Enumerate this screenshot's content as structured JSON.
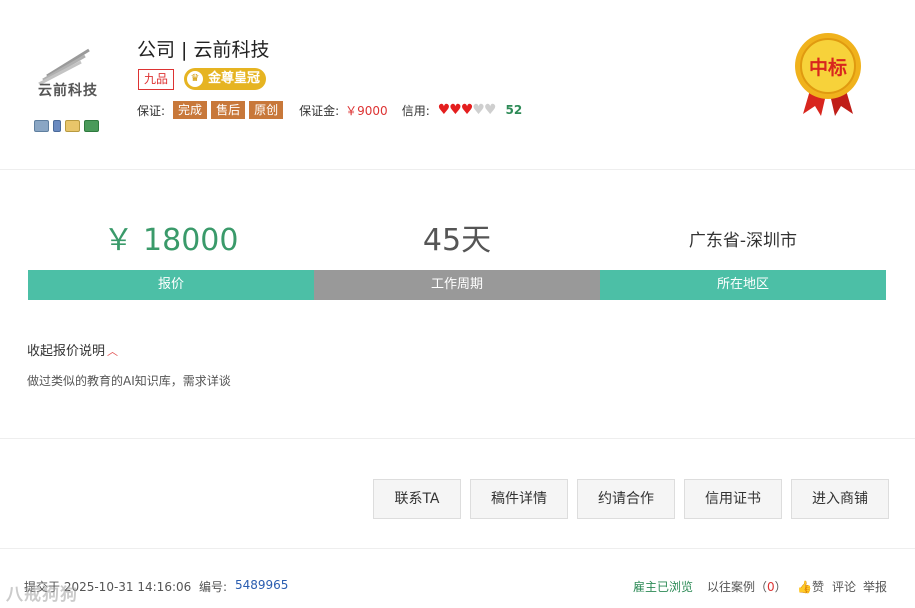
{
  "company": {
    "logo_text": "云前科技",
    "title": "公司 | 云前科技",
    "level_badge": "九品",
    "crown_badge": "金尊皇冠",
    "contact_icons": [
      "id-card-icon",
      "phone-icon",
      "mail-icon",
      "bank-card-icon"
    ]
  },
  "guarantee": {
    "label": "保证:",
    "tags": [
      "完成",
      "售后",
      "原创"
    ],
    "deposit_label": "保证金:",
    "deposit_value": "￥9000",
    "credit_label": "信用:",
    "hearts_filled": 3,
    "hearts_total": 5,
    "credit_score": "52"
  },
  "medal": {
    "text": "中标"
  },
  "stats": {
    "price_value": "￥ 18000",
    "period_value": "45天",
    "region_value": "广东省-深圳市",
    "price_label": "报价",
    "period_label": "工作周期",
    "region_label": "所在地区"
  },
  "quote": {
    "toggle_label": "收起报价说明",
    "description": "做过类似的教育的AI知识库，需求详谈"
  },
  "actions": {
    "contact": "联系TA",
    "draft": "稿件详情",
    "invite": "约请合作",
    "credit_cert": "信用证书",
    "store": "进入商铺"
  },
  "footer": {
    "submitted": "提交于 2025-10-31 14:16:06",
    "number_label": "编号:",
    "number_value": "5489965",
    "viewed": "雇主已浏览",
    "cases_label": "以往案例",
    "cases_count": "0",
    "like": "赞",
    "comment": "评论",
    "report": "举报"
  },
  "watermark": "八戒狗狗"
}
